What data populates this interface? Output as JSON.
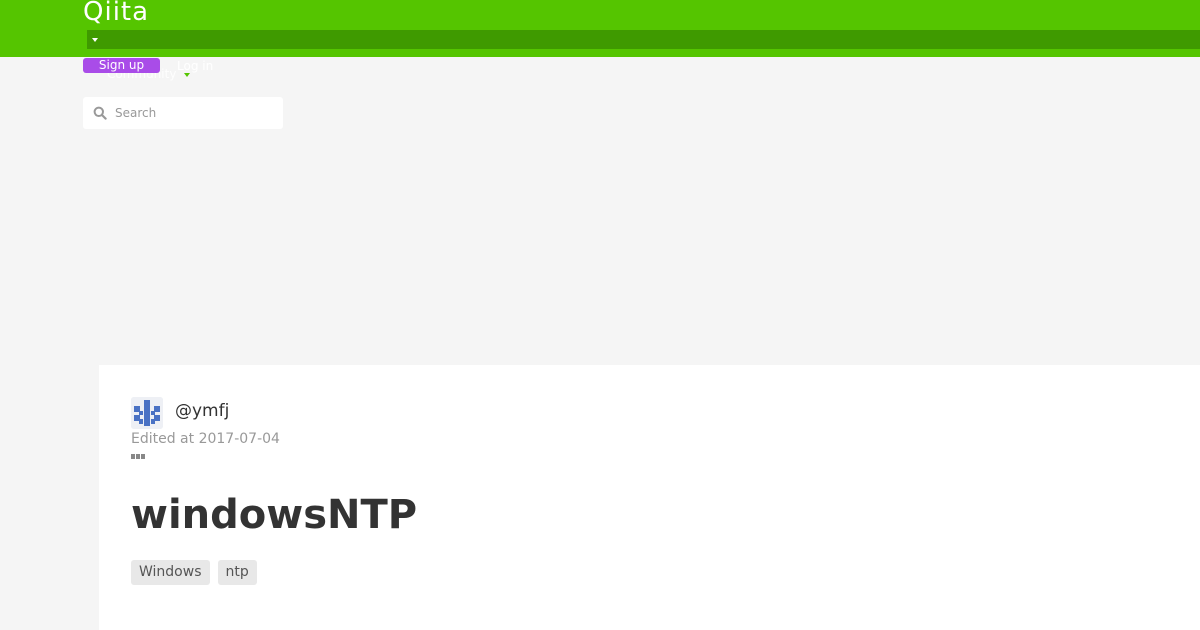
{
  "header": {
    "logo_text": "Qiita",
    "brand_color": "#55c500",
    "signup_label": "Sign up",
    "login_label": "Log in",
    "community_label": "Community",
    "search": {
      "placeholder": "Search",
      "value": ""
    }
  },
  "article": {
    "author": "@ymfj",
    "edited": "Edited at 2017-07-04",
    "title": "windowsNTP",
    "tags": [
      "Windows",
      "ntp"
    ]
  },
  "icons": {
    "search": "search-icon",
    "more": "more-icon",
    "dropdown": "chevron-down-icon"
  }
}
